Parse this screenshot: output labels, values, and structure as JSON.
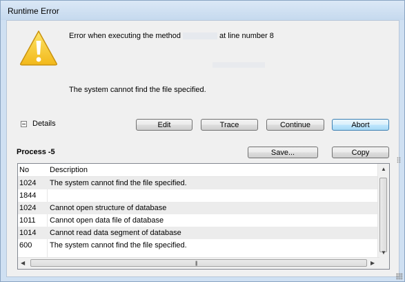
{
  "window": {
    "title": "Runtime Error"
  },
  "message": {
    "line1_prefix": "Error when executing the method",
    "line1_suffix": "at line number 8",
    "line2": "The system cannot find the file specified."
  },
  "details_toggle": {
    "label": "Details",
    "icon": "collapse-minus-icon"
  },
  "actions": {
    "edit": "Edit",
    "trace": "Trace",
    "continue": "Continue",
    "abort": "Abort"
  },
  "process": {
    "title": "Process -5",
    "save": "Save...",
    "copy": "Copy"
  },
  "table": {
    "columns": [
      "No",
      "Description"
    ],
    "rows": [
      {
        "no": "1024",
        "desc": "The system cannot find the file specified."
      },
      {
        "no": "1844",
        "desc": ""
      },
      {
        "no": "1024",
        "desc": "Cannot open structure of database"
      },
      {
        "no": "1011",
        "desc": "Cannot open data file of database"
      },
      {
        "no": "1014",
        "desc": "Cannot read data segment of database"
      },
      {
        "no": "600",
        "desc": "The system cannot find the file specified."
      }
    ]
  },
  "colors": {
    "accent": "#3c7fb1",
    "warning": "#f2c01e"
  }
}
